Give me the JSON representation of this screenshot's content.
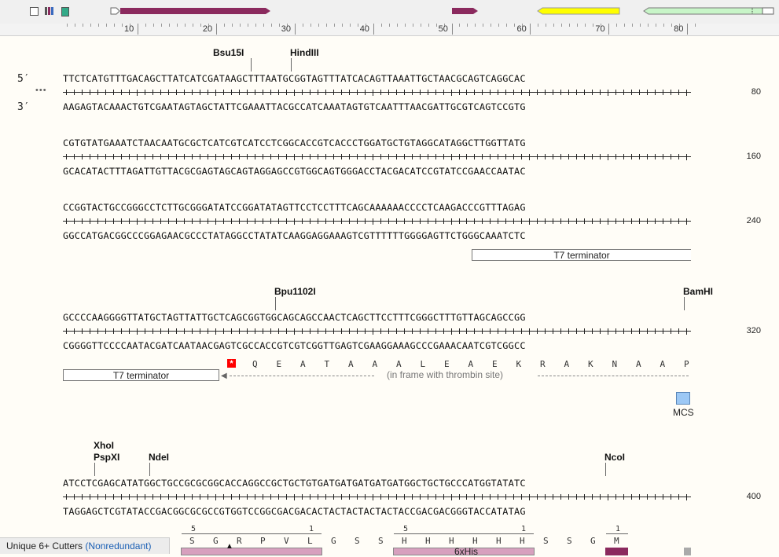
{
  "ruler": {
    "labels": [
      "10",
      "20",
      "30",
      "40",
      "50",
      "60",
      "70",
      "80"
    ]
  },
  "strand_labels": {
    "top": "5′",
    "bottom": "3′",
    "ellipsis": "•••"
  },
  "rows": [
    {
      "top": "TTCTCATGTTTGACAGCTTATCATCGATAAGCTTTAATGCGGTAGTTTATCACAGTTAAATTGCTAACGCAGTCAGGCAC",
      "bottom": "AAGAGTACAAACTGTCGAATAGTAGCTATTCGAAATTACGCCATCAAATAGTGTCAATTTAACGATTGCGTCAGTCCGTG",
      "pos": "80"
    },
    {
      "top": "CGTGTATGAAATCTAACAATGCGCTCATCGTCATCCTCGGCACCGTCACCCTGGATGCTGTAGGCATAGGCTTGGTTATG",
      "bottom": "GCACATACTTTAGATTGTTACGCGAGTAGCAGTAGGAGCCGTGGCAGTGGGACCTACGACATCCGTATCCGAACCAATAC",
      "pos": "160"
    },
    {
      "top": "CCGGTACTGCCGGGCCTCTTGCGGGATATCCGGATATAGTTCCTCCTTTCAGCAAAAAACCCCTCAAGACCCGTTTAGAG",
      "bottom": "GGCCATGACGGCCCGGAGAACGCCCTATAGGCCTATATCAAGGAGGAAAGTCGTTTTTTGGGGAGTTCTGGGCAAATCTC",
      "pos": "240"
    },
    {
      "top": "GCCCCAAGGGGTTATGCTAGTTATTGCTCAGCGGTGGCAGCAGCCAACTCAGCTTCCTTTCGGGCTTTGTTAGCAGCCGG",
      "bottom": "CGGGGTTCCCCAATACGATCAATAACGAGTCGCCACCGTCGTCGGTTGAGTCGAAGGAAAGCCCGAAACAATCGTCGGCC",
      "pos": "320"
    },
    {
      "top": "ATCCTCGAGCATATGGCTGCCGCGCGGCACCAGGCCGCTGCTGTGATGATGATGATGATGGCTGCTGCCCATGGTATATC",
      "bottom": "TAGGAGCTCGTATACCGACGGCGCGCCGTGGTCCGGCGACGACACTACTACTACTACTACCGACGACGGGTACCATATAG",
      "pos": "400"
    }
  ],
  "enzymes": {
    "bsu15i": "Bsu15I",
    "hindiii": "HindIII",
    "bpu1102i": "Bpu1102I",
    "bamhi": "BamHI",
    "xhoi": "XhoI",
    "pspxi": "PspXI",
    "ndei": "NdeI",
    "ncoi": "NcoI"
  },
  "features": {
    "t7_terminator": "T7 terminator",
    "mcs": "MCS",
    "sixhis": "6xHis",
    "frame_note": "(in frame with thrombin site)"
  },
  "translation_row4": [
    "Q",
    "E",
    "A",
    "T",
    "A",
    "A",
    "A",
    "L",
    "E",
    "A",
    "E",
    "K",
    "R",
    "A",
    "K",
    "N",
    "A",
    "A",
    "P"
  ],
  "translation_row5": [
    {
      "n": "5",
      "aa": "S"
    },
    {
      "n": "",
      "aa": "G"
    },
    {
      "n": "",
      "aa": "R"
    },
    {
      "n": "",
      "aa": "P"
    },
    {
      "n": "",
      "aa": "V"
    },
    {
      "n": "1",
      "aa": "L"
    },
    {
      "n": "",
      "aa": "G"
    },
    {
      "n": "",
      "aa": "S"
    },
    {
      "n": "",
      "aa": "S"
    },
    {
      "n": "5",
      "aa": "H"
    },
    {
      "n": "",
      "aa": "H"
    },
    {
      "n": "",
      "aa": "H"
    },
    {
      "n": "",
      "aa": "H"
    },
    {
      "n": "",
      "aa": "H"
    },
    {
      "n": "1",
      "aa": "H"
    },
    {
      "n": "",
      "aa": "S"
    },
    {
      "n": "",
      "aa": "S"
    },
    {
      "n": "",
      "aa": "G"
    },
    {
      "n": "1",
      "aa": "M"
    }
  ],
  "stop_symbol": "*",
  "status": {
    "label": "Unique 6+ Cutters",
    "link": "(Nonredundant)"
  },
  "colors": {
    "map_feature": "#8b2a5e",
    "yellow_feature": "#ffff00",
    "green_feature": "#c8f5c8",
    "mcs": "#9cc8f5",
    "stop": "#ff0000",
    "protein": "#d7a0be"
  }
}
